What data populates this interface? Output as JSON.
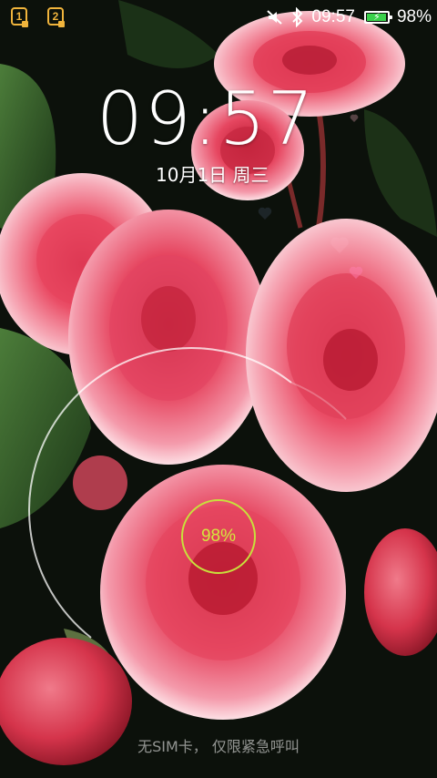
{
  "status_bar": {
    "sim1_label": "1",
    "sim2_label": "2",
    "time": "09:57",
    "battery_percent_text": "98%",
    "battery_level": 0.98,
    "icons": [
      "silent-mode-icon",
      "bluetooth-icon",
      "battery-charging-icon"
    ],
    "accent_color": "#f0b43c",
    "battery_color": "#3ad14b"
  },
  "lockscreen": {
    "clock": "09:57",
    "date": "10月1日 周三",
    "charge_percent": "98%",
    "charge_ring_color": "#c8e03c",
    "footer": "无SIM卡， 仅限紧急呼叫"
  },
  "wallpaper": {
    "subject": "pink-begonia-flowers",
    "colors": [
      "#e8405a",
      "#f7c6cf",
      "#2f5a2a",
      "#0b0f0a"
    ]
  }
}
